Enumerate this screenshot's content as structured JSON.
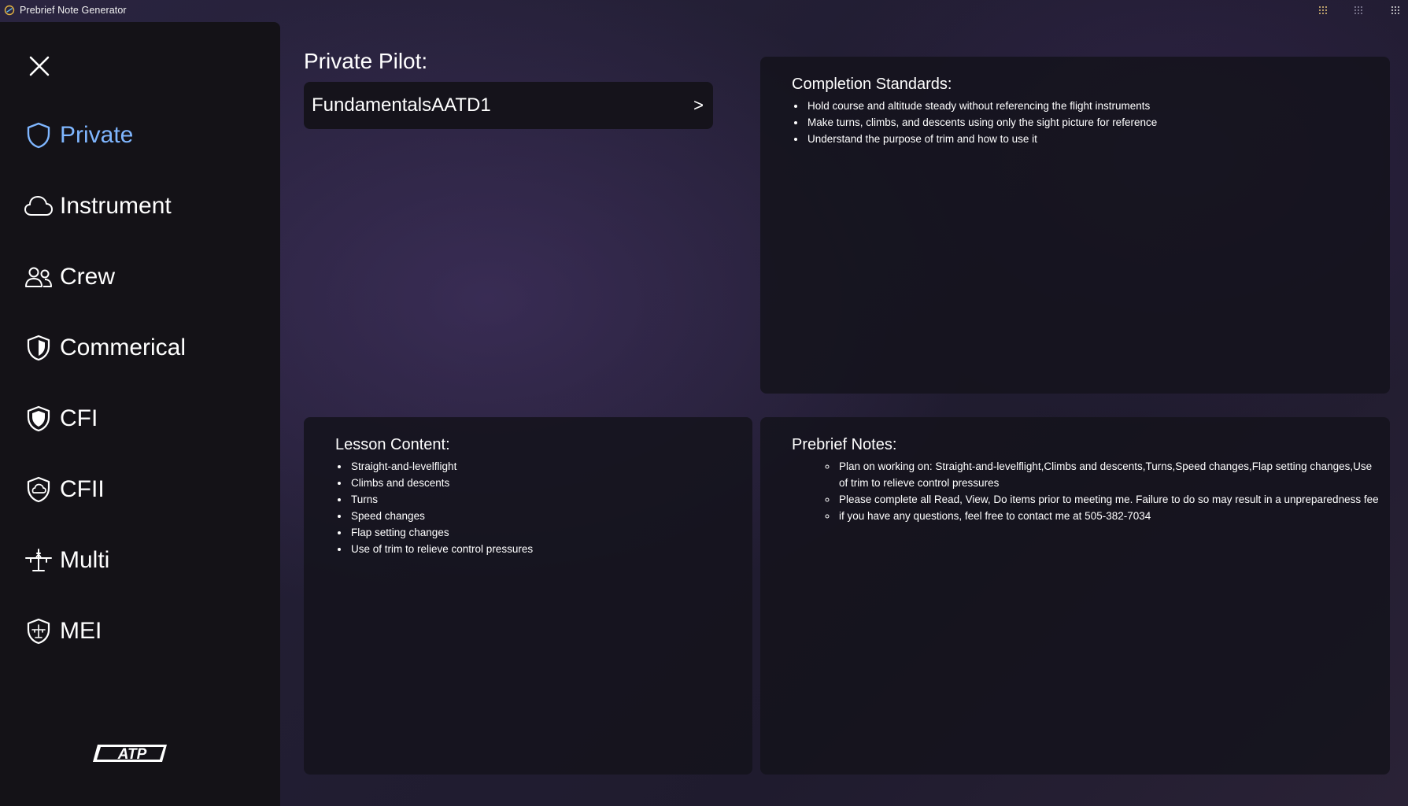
{
  "window": {
    "title": "Prebrief Note Generator"
  },
  "sidebar": {
    "items": [
      {
        "label": "Private",
        "icon": "shield-icon",
        "active": true
      },
      {
        "label": "Instrument",
        "icon": "cloud-icon",
        "active": false
      },
      {
        "label": "Crew",
        "icon": "people-icon",
        "active": false
      },
      {
        "label": "Commerical",
        "icon": "shield-half-icon",
        "active": false
      },
      {
        "label": "CFI",
        "icon": "shield-half-icon",
        "active": false
      },
      {
        "label": "CFII",
        "icon": "shield-cloud-icon",
        "active": false
      },
      {
        "label": "Multi",
        "icon": "airplane-icon",
        "active": false
      },
      {
        "label": "MEI",
        "icon": "shield-airplane-icon",
        "active": false
      }
    ],
    "logo_text": "ATP"
  },
  "main": {
    "section_title": "Private Pilot:",
    "lesson_select": {
      "value": "FundamentalsAATD1",
      "chevron": ">"
    },
    "completion_standards": {
      "title": "Completion Standards:",
      "items": [
        "Hold course and altitude steady without referencing the flight instruments",
        "Make turns, climbs, and descents using only the sight picture for reference",
        "Understand the purpose of trim and how to use it"
      ]
    },
    "lesson_content": {
      "title": "Lesson Content:",
      "items": [
        "Straight-and-levelflight",
        "Climbs and descents",
        "Turns",
        "Speed changes",
        "Flap setting changes",
        "Use of trim to relieve control pressures"
      ]
    },
    "prebrief_notes": {
      "title": "Prebrief Notes:",
      "items": [
        "Plan on working on: Straight-and-levelflight,Climbs and descents,Turns,Speed changes,Flap setting changes,Use of trim to relieve control pressures",
        "Please complete all Read, View, Do items prior to meeting me. Failure to do so may result in a unpreparedness fee",
        "if you have any questions, feel free to contact me at 505-382-7034"
      ]
    }
  },
  "colors": {
    "active_nav": "#7fb6ff",
    "sidebar_bg": "#141217",
    "panel_bg": "#15131b",
    "tb_grid_1": "#e8c77a",
    "tb_grid_2": "#8d8aa0",
    "tb_grid_3": "#e3e3e3"
  }
}
